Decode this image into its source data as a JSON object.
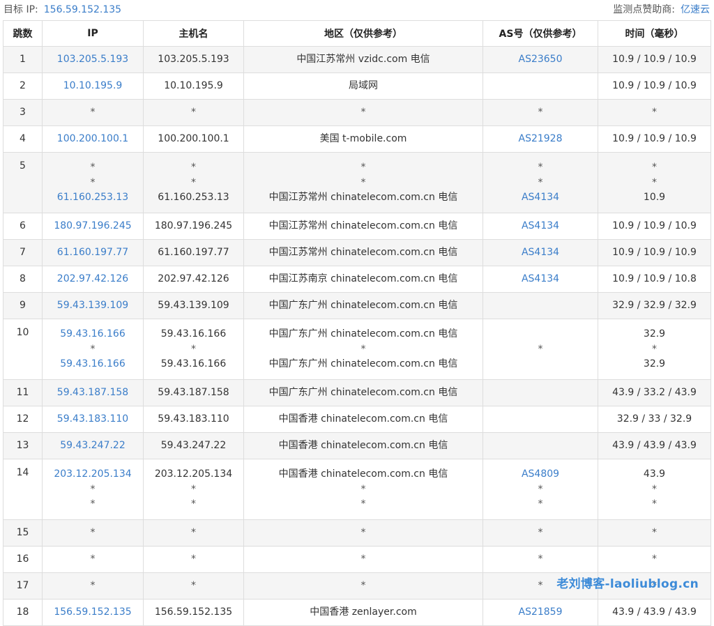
{
  "header": {
    "target_label": "目标 IP:",
    "target_ip": "156.59.152.135",
    "sponsor_label": "监测点赞助商:",
    "sponsor_name": "亿速云"
  },
  "columns": [
    "跳数",
    "IP",
    "主机名",
    "地区（仅供参考）",
    "AS号（仅供参考）",
    "时间（毫秒）"
  ],
  "rows": [
    {
      "hop": "1",
      "lines": [
        [
          "103.205.5.193",
          "103.205.5.193",
          "中国江苏常州 vzidc.com 电信",
          "AS23650",
          "10.9 / 10.9 / 10.9"
        ]
      ]
    },
    {
      "hop": "2",
      "lines": [
        [
          "10.10.195.9",
          "10.10.195.9",
          "局域网",
          "",
          "10.9 / 10.9 / 10.9"
        ]
      ]
    },
    {
      "hop": "3",
      "lines": [
        [
          "*",
          "*",
          "*",
          "*",
          "*"
        ]
      ]
    },
    {
      "hop": "4",
      "lines": [
        [
          "100.200.100.1",
          "100.200.100.1",
          "美国 t-mobile.com",
          "AS21928",
          "10.9 / 10.9 / 10.9"
        ]
      ]
    },
    {
      "hop": "5",
      "lines": [
        [
          "*",
          "*",
          "*",
          "*",
          "*"
        ],
        [
          "*",
          "*",
          "*",
          "*",
          "*"
        ],
        [
          "61.160.253.13",
          "61.160.253.13",
          "中国江苏常州 chinatelecom.com.cn 电信",
          "AS4134",
          "10.9"
        ]
      ]
    },
    {
      "hop": "6",
      "lines": [
        [
          "180.97.196.245",
          "180.97.196.245",
          "中国江苏常州 chinatelecom.com.cn 电信",
          "AS4134",
          "10.9 / 10.9 / 10.9"
        ]
      ]
    },
    {
      "hop": "7",
      "lines": [
        [
          "61.160.197.77",
          "61.160.197.77",
          "中国江苏常州 chinatelecom.com.cn 电信",
          "AS4134",
          "10.9 / 10.9 / 10.9"
        ]
      ]
    },
    {
      "hop": "8",
      "lines": [
        [
          "202.97.42.126",
          "202.97.42.126",
          "中国江苏南京 chinatelecom.com.cn 电信",
          "AS4134",
          "10.9 / 10.9 / 10.8"
        ]
      ]
    },
    {
      "hop": "9",
      "lines": [
        [
          "59.43.139.109",
          "59.43.139.109",
          "中国广东广州 chinatelecom.com.cn 电信",
          "",
          "32.9 / 32.9 / 32.9"
        ]
      ]
    },
    {
      "hop": "10",
      "lines": [
        [
          "59.43.16.166",
          "59.43.16.166",
          "中国广东广州 chinatelecom.com.cn 电信",
          "",
          "32.9"
        ],
        [
          "*",
          "*",
          "*",
          "*",
          "*"
        ],
        [
          "59.43.16.166",
          "59.43.16.166",
          "中国广东广州 chinatelecom.com.cn 电信",
          "",
          "32.9"
        ]
      ]
    },
    {
      "hop": "11",
      "lines": [
        [
          "59.43.187.158",
          "59.43.187.158",
          "中国广东广州 chinatelecom.com.cn 电信",
          "",
          "43.9 / 33.2 / 43.9"
        ]
      ]
    },
    {
      "hop": "12",
      "lines": [
        [
          "59.43.183.110",
          "59.43.183.110",
          "中国香港 chinatelecom.com.cn 电信",
          "",
          "32.9 / 33 / 32.9"
        ]
      ]
    },
    {
      "hop": "13",
      "lines": [
        [
          "59.43.247.22",
          "59.43.247.22",
          "中国香港 chinatelecom.com.cn 电信",
          "",
          "43.9 / 43.9 / 43.9"
        ]
      ]
    },
    {
      "hop": "14",
      "lines": [
        [
          "203.12.205.134",
          "203.12.205.134",
          "中国香港 chinatelecom.com.cn 电信",
          "AS4809",
          "43.9"
        ],
        [
          "*",
          "*",
          "*",
          "*",
          "*"
        ],
        [
          "*",
          "*",
          "*",
          "*",
          "*"
        ]
      ]
    },
    {
      "hop": "15",
      "lines": [
        [
          "*",
          "*",
          "*",
          "*",
          "*"
        ]
      ]
    },
    {
      "hop": "16",
      "lines": [
        [
          "*",
          "*",
          "*",
          "*",
          "*"
        ]
      ]
    },
    {
      "hop": "17",
      "lines": [
        [
          "*",
          "*",
          "*",
          "*",
          "*"
        ]
      ]
    },
    {
      "hop": "18",
      "lines": [
        [
          "156.59.152.135",
          "156.59.152.135",
          "中国香港 zenlayer.com",
          "AS21859",
          "43.9 / 43.9 / 43.9"
        ]
      ]
    }
  ],
  "watermark": "老刘博客-laoliublog.cn",
  "colors": {
    "link": "#3a7dc9",
    "row_alt": "#f5f5f5",
    "border": "#dddddd",
    "watermark": "#3d8bd8"
  }
}
